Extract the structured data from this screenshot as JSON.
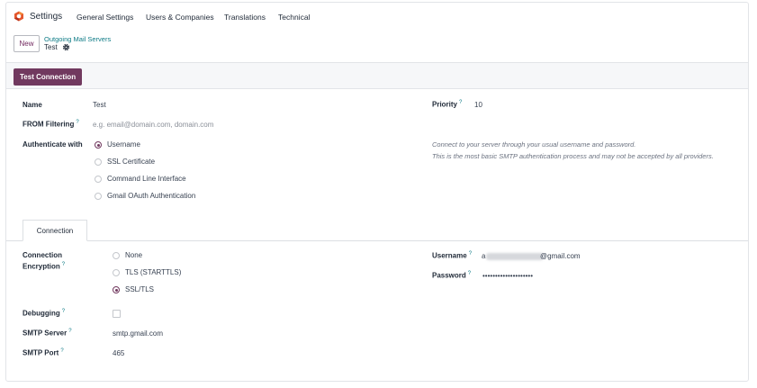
{
  "topnav": {
    "app_name": "Settings",
    "menu": [
      "General Settings",
      "Users & Companies",
      "Translations",
      "Technical"
    ]
  },
  "breadcrumb": {
    "new_label": "New",
    "parent": "Outgoing Mail Servers",
    "current": "Test"
  },
  "actions": {
    "test_connection": "Test Connection"
  },
  "form": {
    "name_label": "Name",
    "name_value": "Test",
    "from_filter_label": "FROM Filtering",
    "from_filter_placeholder": "e.g. email@domain.com, domain.com",
    "auth_label": "Authenticate with",
    "auth_options": [
      "Username",
      "SSL Certificate",
      "Command Line Interface",
      "Gmail OAuth Authentication"
    ],
    "auth_selected": "Username",
    "priority_label": "Priority",
    "priority_value": "10",
    "hint_line1": "Connect to your server through your usual username and password.",
    "hint_line2": "This is the most basic SMTP authentication process and may not be accepted by all providers."
  },
  "tabs": [
    "Connection"
  ],
  "connection": {
    "encryption_label_1": "Connection",
    "encryption_label_2": "Encryption",
    "encryption_options": [
      "None",
      "TLS (STARTTLS)",
      "SSL/TLS"
    ],
    "encryption_selected": "SSL/TLS",
    "debugging_label": "Debugging",
    "smtp_server_label": "SMTP Server",
    "smtp_server_value": "smtp.gmail.com",
    "smtp_port_label": "SMTP Port",
    "smtp_port_value": "465",
    "username_label": "Username",
    "username_prefix": "a",
    "username_suffix": "@gmail.com",
    "password_label": "Password",
    "password_value": "••••••••••••••••••••"
  },
  "help_marker": "?",
  "colors": {
    "brand": "#71395f",
    "link": "#0e7b86"
  },
  "icons": {
    "app_logo": "odoo-settings-icon",
    "record_gear": "gear-icon"
  }
}
